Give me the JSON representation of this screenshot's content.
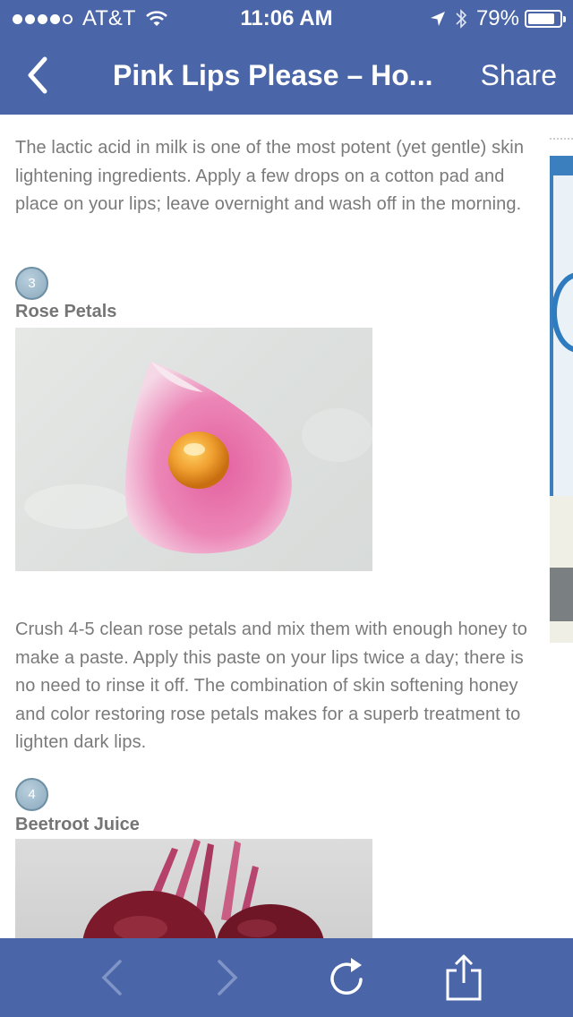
{
  "status_bar": {
    "carrier": "AT&T",
    "signal_bars": 4,
    "signal_total": 5,
    "time": "11:06 AM",
    "battery_percent": "79%",
    "battery_level": 0.79
  },
  "navbar": {
    "title": "Pink Lips Please – Ho...",
    "share_label": "Share"
  },
  "article": {
    "intro_paragraph": "The lactic acid in milk is one of the most potent (yet gentle) skin lightening ingredients. Apply a few drops on a cotton pad and place on your lips; leave overnight and wash off in the morning.",
    "steps": [
      {
        "number": "3",
        "title": "Rose Petals",
        "text": "Crush 4-5 clean rose petals and mix them with enough honey to make a paste. Apply this paste on your lips twice a day; there is no need to rinse it off. The combination of skin softening honey and color restoring rose petals makes for a superb treatment to lighten dark lips."
      },
      {
        "number": "4",
        "title": "Beetroot Juice"
      }
    ]
  },
  "colors": {
    "bar_blue": "#4a65a8",
    "text_gray": "#7a7a7a",
    "badge_blue": "#8aa9bd"
  },
  "icons": {
    "back": "chevron-left-icon",
    "forward": "chevron-right-icon",
    "reload": "reload-icon",
    "share": "share-icon"
  }
}
